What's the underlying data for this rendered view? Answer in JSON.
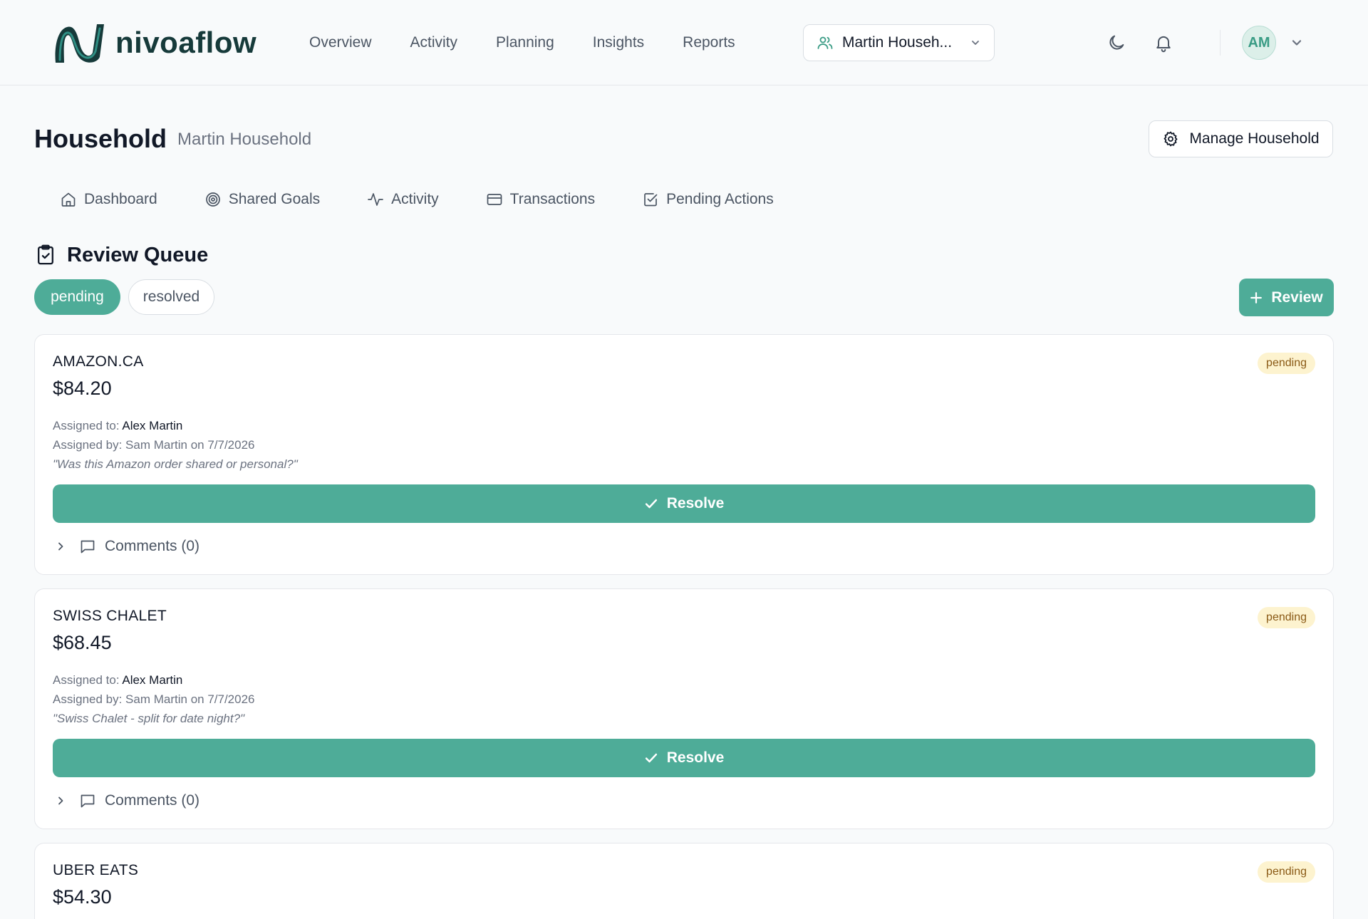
{
  "brand": {
    "name": "nivoaflow"
  },
  "nav": {
    "items": [
      {
        "label": "Overview"
      },
      {
        "label": "Activity"
      },
      {
        "label": "Planning"
      },
      {
        "label": "Insights"
      },
      {
        "label": "Reports"
      }
    ],
    "household_selector": "Martin Househ...",
    "avatar_initials": "AM"
  },
  "page": {
    "title": "Household",
    "subtitle": "Martin Household",
    "manage_button": "Manage Household"
  },
  "subtabs": [
    {
      "label": "Dashboard",
      "icon": "home-icon"
    },
    {
      "label": "Shared Goals",
      "icon": "target-icon"
    },
    {
      "label": "Activity",
      "icon": "activity-icon"
    },
    {
      "label": "Transactions",
      "icon": "credit-card-icon"
    },
    {
      "label": "Pending Actions",
      "icon": "checkbox-icon"
    }
  ],
  "review_queue": {
    "title": "Review Queue",
    "filters": {
      "pending": "pending",
      "resolved": "resolved"
    },
    "add_button": "Review",
    "assigned_to_label": "Assigned to:",
    "cards": [
      {
        "merchant": "AMAZON.CA",
        "amount": "$84.20",
        "status": "pending",
        "assigned_to": "Alex Martin",
        "assigned_by": "Assigned by: Sam Martin on 7/7/2026",
        "note": "\"Was this Amazon order shared or personal?\"",
        "resolve_label": "Resolve",
        "comments_label": "Comments (0)"
      },
      {
        "merchant": "SWISS CHALET",
        "amount": "$68.45",
        "status": "pending",
        "assigned_to": "Alex Martin",
        "assigned_by": "Assigned by: Sam Martin on 7/7/2026",
        "note": "\"Swiss Chalet - split for date night?\"",
        "resolve_label": "Resolve",
        "comments_label": "Comments (0)"
      },
      {
        "merchant": "UBER EATS",
        "amount": "$54.30",
        "status": "pending"
      }
    ]
  },
  "colors": {
    "accent": "#4eac98",
    "badge_bg": "#fdf3cf",
    "badge_text": "#8a5a16",
    "brand_dark": "#163a3a"
  }
}
